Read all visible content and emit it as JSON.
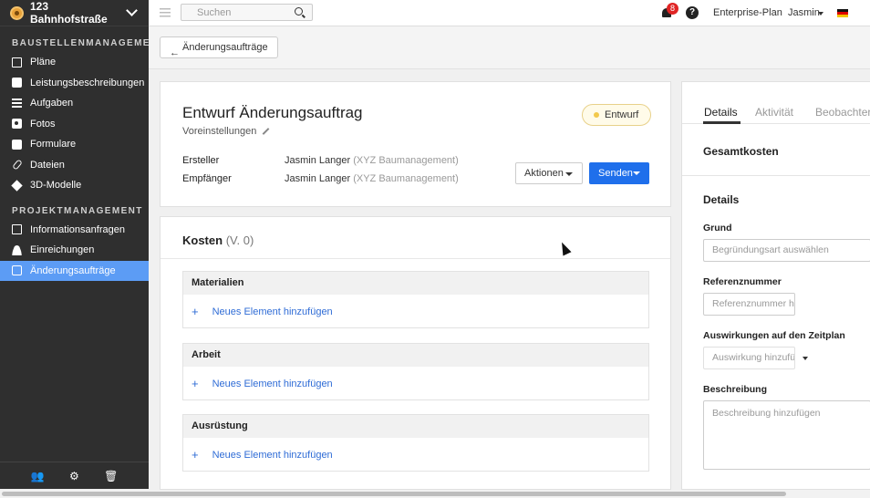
{
  "project": {
    "name": "123 Bahnhofstraße"
  },
  "sidebar": {
    "section1_title": "BAUSTELLENMANAGEMENT",
    "section1_items": [
      {
        "label": "Pläne",
        "icon": "plans-icon"
      },
      {
        "label": "Leistungsbeschreibungen",
        "icon": "specs-icon"
      },
      {
        "label": "Aufgaben",
        "icon": "tasks-icon"
      },
      {
        "label": "Fotos",
        "icon": "camera-icon"
      },
      {
        "label": "Formulare",
        "icon": "forms-icon"
      },
      {
        "label": "Dateien",
        "icon": "paperclip-icon"
      },
      {
        "label": "3D-Modelle",
        "icon": "cube-icon"
      }
    ],
    "section2_title": "PROJEKTMANAGEMENT",
    "section2_items": [
      {
        "label": "Informationsanfragen",
        "icon": "rfi-icon"
      },
      {
        "label": "Einreichungen",
        "icon": "person-icon"
      },
      {
        "label": "Änderungsaufträge",
        "icon": "change-order-icon",
        "active": true
      }
    ]
  },
  "topbar": {
    "search_placeholder": "Suchen",
    "notifications_count": "8",
    "help_label": "?",
    "plan": "Enterprise-Plan",
    "user": "Jasmin"
  },
  "back_button": {
    "label": "Änderungsaufträge"
  },
  "header": {
    "title": "Entwurf Änderungsauftrag",
    "preset": "Voreinstellungen",
    "status": "Entwurf",
    "creator_label": "Ersteller",
    "creator_name": "Jasmin Langer",
    "creator_org": "(XYZ Baumanagement)",
    "recipient_label": "Empfänger",
    "recipient_name": "Jasmin Langer",
    "recipient_org": "(XYZ Baumanagement)",
    "actions_label": "Aktionen",
    "send_label": "Senden"
  },
  "costs": {
    "title": "Kosten",
    "version": "(V. 0)",
    "groups": [
      {
        "name": "Materialien",
        "add_label": "Neues Element hinzufügen"
      },
      {
        "name": "Arbeit",
        "add_label": "Neues Element hinzufügen"
      },
      {
        "name": "Ausrüstung",
        "add_label": "Neues Element hinzufügen"
      }
    ]
  },
  "right_panel": {
    "tabs": [
      "Details",
      "Aktivität",
      "Beobachter"
    ],
    "total_costs": "Gesamtkosten",
    "details_title": "Details",
    "reason_label": "Grund",
    "reason_placeholder": "Begründungsart auswählen",
    "ref_label": "Referenznummer",
    "ref_placeholder": "Referenznummer h",
    "schedule_label": "Auswirkungen auf den Zeitplan",
    "schedule_placeholder": "Auswirkung hinzufügen",
    "description_label": "Beschreibung",
    "description_placeholder": "Beschreibung hinzufügen"
  },
  "colors": {
    "sidebar_bg": "#2f2f2f",
    "active_nav": "#5c9cf5",
    "primary": "#1f6feb",
    "link": "#2f6cd6"
  }
}
